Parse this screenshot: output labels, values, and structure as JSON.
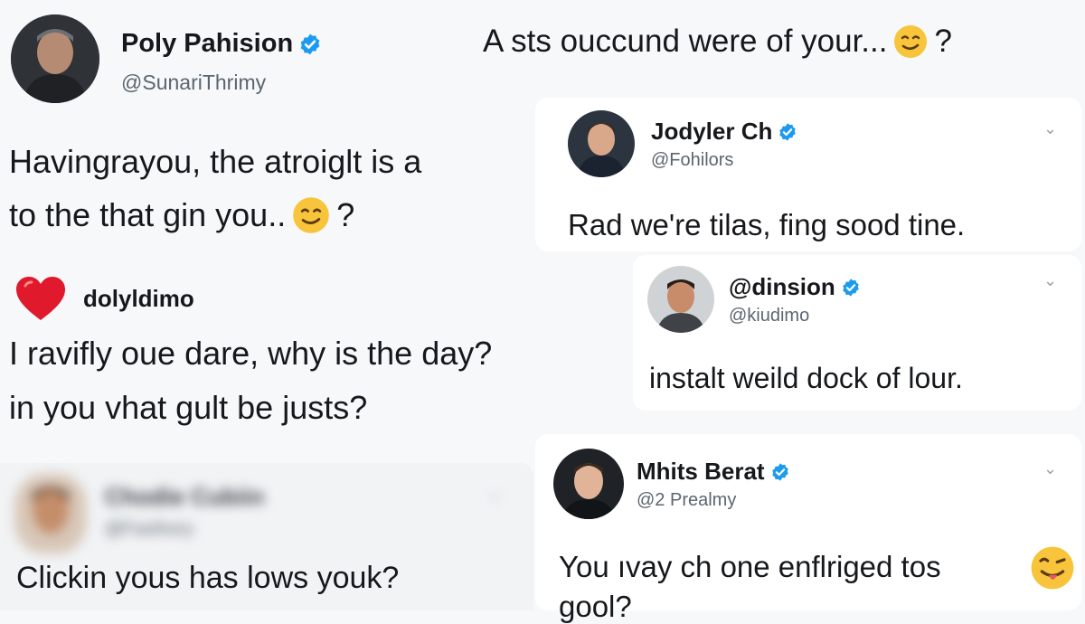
{
  "post1": {
    "name": "Poly Pahision",
    "handle": "@SunariThrimy",
    "header_text": "A sts ouccund were of your...",
    "header_tail": "?",
    "body_line1": "Havingrayou, the atroiglt is a",
    "body_line2": "to the that gin you..",
    "body_tail": "?"
  },
  "reply1": {
    "name": "Jodyler Ch",
    "handle": "@Fohilors",
    "text": "Rad we're tilas, fing sood tine."
  },
  "comment1": {
    "name": "dolyldimo",
    "line1": "I ravifly oue dare, why is the day?",
    "line2": "in you vhat gult be justs?"
  },
  "reply2": {
    "name": "@dinsion",
    "handle": "@kiudimo",
    "text": "instalt weild dock of lour."
  },
  "blurred_post": {
    "name": "Chodie Cubiin",
    "handle": "@Fasthory",
    "text": "Clickin yous has lows youk?"
  },
  "reply3": {
    "name": "Mhits Berat",
    "handle": "@2 Prealmy",
    "text_line1": "You ıvay ch one enflriged tos",
    "text_line2": "gool?"
  },
  "colors": {
    "verified": "#1d9bf0",
    "heart": "#e0192c",
    "emoji": "#f7c43b"
  },
  "icons": [
    "verified-badge-icon",
    "heart-icon",
    "chevron-down-icon",
    "smirk-emoji-icon",
    "tongue-emoji-icon"
  ]
}
